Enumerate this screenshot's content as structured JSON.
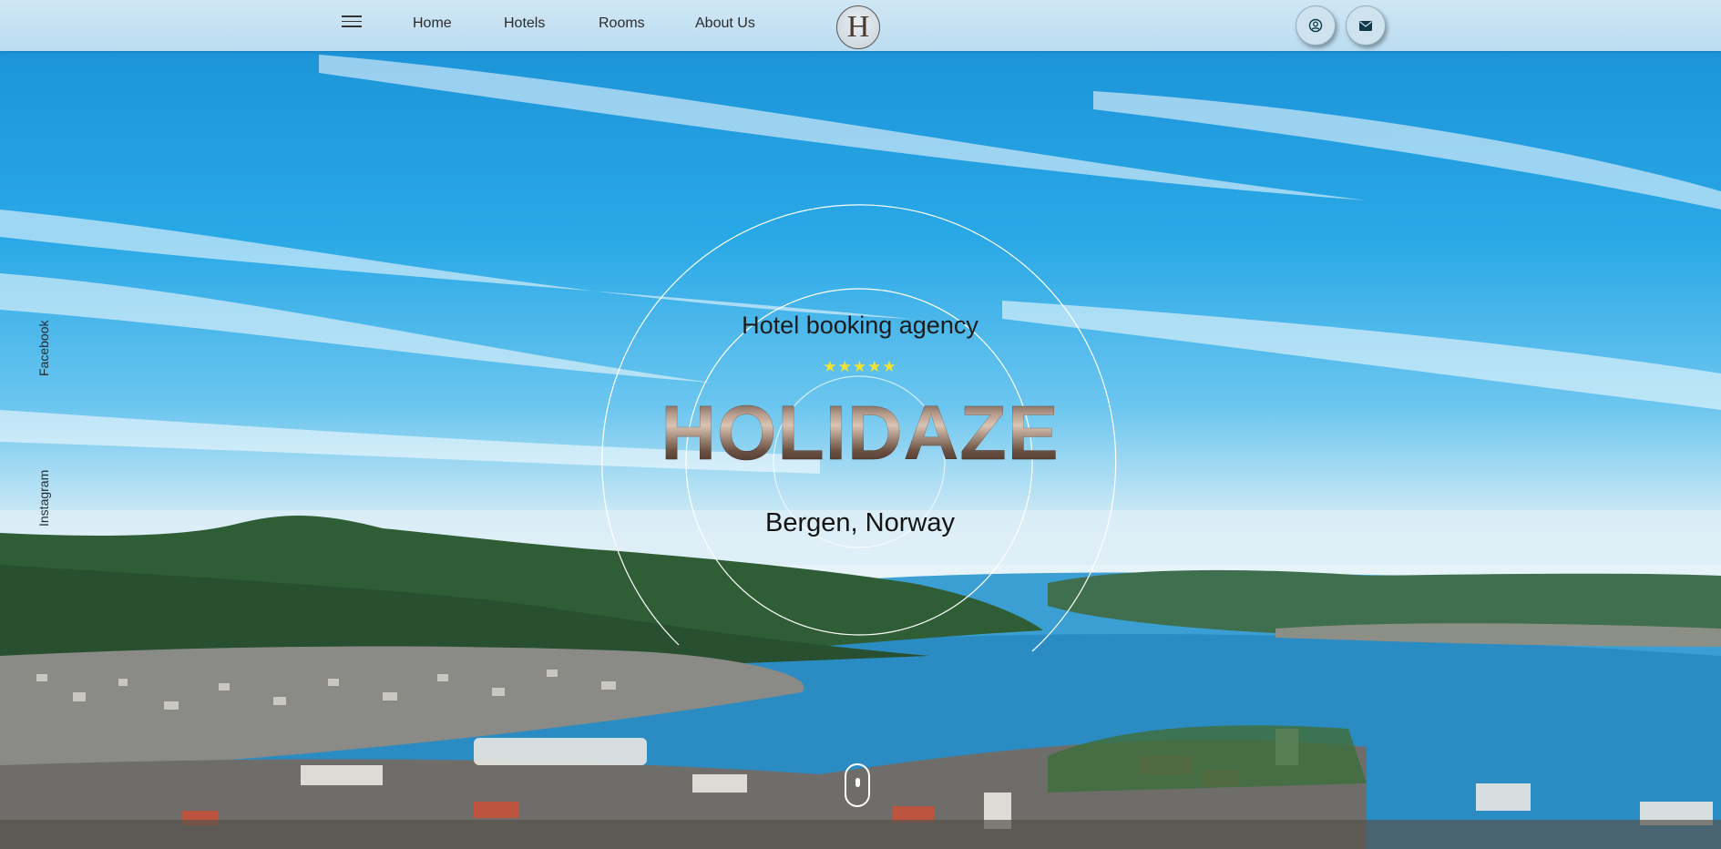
{
  "nav": {
    "menu_icon": "hamburger-menu-icon",
    "items": [
      {
        "label": "Home"
      },
      {
        "label": "Hotels"
      },
      {
        "label": "Rooms"
      },
      {
        "label": "About Us"
      }
    ],
    "logo_letter": "H",
    "account_icon": "user-circle-icon",
    "mail_icon": "envelope-icon"
  },
  "social": {
    "facebook": "Facebook",
    "instagram": "Instagram"
  },
  "hero": {
    "tagline": "Hotel booking agency",
    "stars": "★★★★★",
    "star_rating": 5,
    "brand": "HOLIDAZE",
    "location": "Bergen, Norway"
  },
  "colors": {
    "topbar": "#cfe3f2",
    "text_dark": "#1b1b1b",
    "star": "#f1e334",
    "brand_bronze": "#b89e8e",
    "sky": "#29a8e6",
    "sea": "#2b8cc4"
  }
}
